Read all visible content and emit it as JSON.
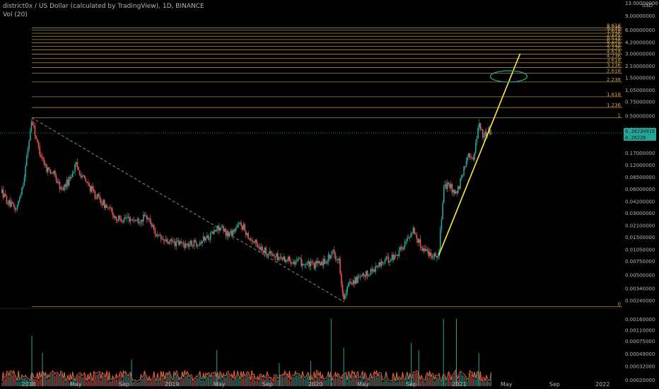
{
  "header": {
    "title": "district0x / US Dollar (calculated by TradingView), 1D, BINANCE",
    "indicator": "Vol (20)"
  },
  "colors": {
    "up": "#26a69a",
    "down": "#ef5350",
    "fib": "#c9a24b",
    "trendline": "#ffeb3b",
    "ellipse": "#26a69a",
    "volume_ma": "#ff7043",
    "price_line": "#26a69a"
  },
  "chart_data": {
    "type": "candlestick",
    "scale": "log",
    "price_axis": {
      "unit_label": "USD",
      "range": [
        0.0019,
        13.0
      ],
      "ticks": [
        {
          "label": "13.00000000",
          "value": 13.0
        },
        {
          "label": "9.00000000",
          "value": 9.0
        },
        {
          "label": "6.00000000",
          "value": 6.0
        },
        {
          "label": "4.20000000",
          "value": 4.2
        },
        {
          "label": "3.00000000",
          "value": 3.0
        },
        {
          "label": "2.10000000",
          "value": 2.1
        },
        {
          "label": "1.50000000",
          "value": 1.5
        },
        {
          "label": "1.05000000",
          "value": 1.05
        },
        {
          "label": "0.75000000",
          "value": 0.75
        },
        {
          "label": "0.50000000",
          "value": 0.5
        },
        {
          "label": "0.34000000",
          "value": 0.34
        },
        {
          "label": "0.17000000",
          "value": 0.17
        },
        {
          "label": "0.12000000",
          "value": 0.12
        },
        {
          "label": "0.08500000",
          "value": 0.085
        },
        {
          "label": "0.06000000",
          "value": 0.06
        },
        {
          "label": "0.04200000",
          "value": 0.042
        },
        {
          "label": "0.03000000",
          "value": 0.03
        },
        {
          "label": "0.02100000",
          "value": 0.021
        },
        {
          "label": "0.01500000",
          "value": 0.015
        },
        {
          "label": "0.01050000",
          "value": 0.0105
        },
        {
          "label": "0.00750000",
          "value": 0.0075
        },
        {
          "label": "0.00500000",
          "value": 0.005
        },
        {
          "label": "0.00340000",
          "value": 0.0034
        },
        {
          "label": "0.00240000",
          "value": 0.0024
        }
      ]
    },
    "volume_axis": {
      "ticks": [
        {
          "label": "0.00160000",
          "value": 0.0016
        },
        {
          "label": "0.00110000",
          "value": 0.0011
        },
        {
          "label": "0.00075000",
          "value": 0.00075
        },
        {
          "label": "0.00049000",
          "value": 0.00049
        },
        {
          "label": "0.00032000",
          "value": 0.00032
        },
        {
          "label": "0.00020000",
          "value": 0.0002
        }
      ]
    },
    "time_axis": {
      "range": [
        "2017-10-20",
        "2022-02-20"
      ],
      "ticks": [
        {
          "label": "2018",
          "date": "2018-01-01"
        },
        {
          "label": "May",
          "date": "2018-05-01"
        },
        {
          "label": "Sep",
          "date": "2018-09-01"
        },
        {
          "label": "2019",
          "date": "2019-01-01"
        },
        {
          "label": "May",
          "date": "2019-05-01"
        },
        {
          "label": "Sep",
          "date": "2019-09-01"
        },
        {
          "label": "2020",
          "date": "2020-01-01"
        },
        {
          "label": "May",
          "date": "2020-05-01"
        },
        {
          "label": "Sep",
          "date": "2020-09-01"
        },
        {
          "label": "2021",
          "date": "2021-01-01"
        },
        {
          "label": "May",
          "date": "2021-05-01"
        },
        {
          "label": "Sep",
          "date": "2021-09-01"
        },
        {
          "label": "2022",
          "date": "2022-01-01"
        }
      ]
    },
    "price_path": [
      {
        "date": "2017-10-25",
        "price": 0.055
      },
      {
        "date": "2017-11-10",
        "price": 0.04
      },
      {
        "date": "2017-12-01",
        "price": 0.033
      },
      {
        "date": "2017-12-20",
        "price": 0.08
      },
      {
        "date": "2018-01-09",
        "price": 0.46
      },
      {
        "date": "2018-01-25",
        "price": 0.2
      },
      {
        "date": "2018-02-15",
        "price": 0.11
      },
      {
        "date": "2018-03-05",
        "price": 0.095
      },
      {
        "date": "2018-03-25",
        "price": 0.058
      },
      {
        "date": "2018-04-12",
        "price": 0.075
      },
      {
        "date": "2018-05-01",
        "price": 0.12
      },
      {
        "date": "2018-05-25",
        "price": 0.075
      },
      {
        "date": "2018-06-20",
        "price": 0.05
      },
      {
        "date": "2018-07-20",
        "price": 0.035
      },
      {
        "date": "2018-08-15",
        "price": 0.025
      },
      {
        "date": "2018-09-10",
        "price": 0.026
      },
      {
        "date": "2018-10-05",
        "price": 0.024
      },
      {
        "date": "2018-10-30",
        "price": 0.027
      },
      {
        "date": "2018-11-25",
        "price": 0.015
      },
      {
        "date": "2018-12-15",
        "price": 0.013
      },
      {
        "date": "2019-01-10",
        "price": 0.0125
      },
      {
        "date": "2019-02-10",
        "price": 0.012
      },
      {
        "date": "2019-03-10",
        "price": 0.013
      },
      {
        "date": "2019-04-10",
        "price": 0.016
      },
      {
        "date": "2019-05-01",
        "price": 0.02
      },
      {
        "date": "2019-05-25",
        "price": 0.016
      },
      {
        "date": "2019-06-25",
        "price": 0.022
      },
      {
        "date": "2019-07-20",
        "price": 0.014
      },
      {
        "date": "2019-08-20",
        "price": 0.0105
      },
      {
        "date": "2019-09-20",
        "price": 0.0085
      },
      {
        "date": "2019-10-25",
        "price": 0.0078
      },
      {
        "date": "2019-11-25",
        "price": 0.0072
      },
      {
        "date": "2019-12-25",
        "price": 0.0065
      },
      {
        "date": "2020-01-25",
        "price": 0.0075
      },
      {
        "date": "2020-02-15",
        "price": 0.0095
      },
      {
        "date": "2020-03-01",
        "price": 0.0075
      },
      {
        "date": "2020-03-13",
        "price": 0.0024
      },
      {
        "date": "2020-03-28",
        "price": 0.0041
      },
      {
        "date": "2020-04-25",
        "price": 0.0045
      },
      {
        "date": "2020-05-25",
        "price": 0.0058
      },
      {
        "date": "2020-06-25",
        "price": 0.0075
      },
      {
        "date": "2020-07-20",
        "price": 0.0085
      },
      {
        "date": "2020-08-15",
        "price": 0.012
      },
      {
        "date": "2020-09-05",
        "price": 0.019
      },
      {
        "date": "2020-09-25",
        "price": 0.0115
      },
      {
        "date": "2020-10-20",
        "price": 0.0092
      },
      {
        "date": "2020-11-10",
        "price": 0.0088
      },
      {
        "date": "2020-11-22",
        "price": 0.06
      },
      {
        "date": "2020-12-05",
        "price": 0.068
      },
      {
        "date": "2020-12-25",
        "price": 0.052
      },
      {
        "date": "2021-01-05",
        "price": 0.075
      },
      {
        "date": "2021-01-25",
        "price": 0.18
      },
      {
        "date": "2021-02-05",
        "price": 0.13
      },
      {
        "date": "2021-02-20",
        "price": 0.42
      },
      {
        "date": "2021-03-05",
        "price": 0.26
      },
      {
        "date": "2021-03-15",
        "price": 0.34
      },
      {
        "date": "2021-03-25",
        "price": 0.29
      }
    ],
    "volume_spikes": [
      {
        "date": "2018-01-09",
        "volume": 0.0009
      },
      {
        "date": "2018-02-05",
        "volume": 0.0005
      },
      {
        "date": "2018-09-20",
        "volume": 0.0004
      },
      {
        "date": "2019-04-25",
        "volume": 0.00055
      },
      {
        "date": "2019-10-01",
        "volume": 0.00035
      },
      {
        "date": "2019-12-20",
        "volume": 0.00038
      },
      {
        "date": "2020-02-10",
        "volume": 0.0016
      },
      {
        "date": "2020-03-13",
        "volume": 0.0006
      },
      {
        "date": "2020-09-01",
        "volume": 0.0007
      },
      {
        "date": "2020-09-20",
        "volume": 0.00055
      },
      {
        "date": "2020-11-22",
        "volume": 0.0016
      },
      {
        "date": "2020-12-25",
        "volume": 0.0016
      },
      {
        "date": "2021-02-20",
        "volume": 0.0005
      }
    ],
    "current_price_labels": [
      "0.30234919",
      "0.26226"
    ],
    "current_price": 0.302,
    "fib_extension": {
      "from": {
        "date": "2018-01-09",
        "price": 0.47
      },
      "to": {
        "date": "2020-03-13",
        "price": 0.002
      },
      "x_start": "2018-01-09",
      "x_end": "2022-02-20",
      "levels": [
        {
          "label": "0",
          "value": 0.002
        },
        {
          "label": "1",
          "value": 0.47
        },
        {
          "label": "1.236",
          "value": 0.63
        },
        {
          "label": "1.618",
          "value": 0.86
        },
        {
          "label": "2.236",
          "value": 1.32
        },
        {
          "label": "2.618",
          "value": 1.7
        },
        {
          "label": "3.236",
          "value": 2.0
        },
        {
          "label": "3.618",
          "value": 2.3
        },
        {
          "label": "4.236",
          "value": 2.6
        },
        {
          "label": "4.618",
          "value": 2.95
        },
        {
          "label": "5.236",
          "value": 3.35
        },
        {
          "label": "5.618",
          "value": 3.7
        },
        {
          "label": "6.236",
          "value": 4.1
        },
        {
          "label": "6.618",
          "value": 4.5
        },
        {
          "label": "7.236",
          "value": 4.95
        },
        {
          "label": "7.618",
          "value": 5.4
        },
        {
          "label": "8.236",
          "value": 5.9
        },
        {
          "label": "8.618",
          "value": 6.3
        }
      ]
    },
    "annotations": {
      "dashed_diagonal": {
        "from": {
          "date": "2018-01-09",
          "price": 0.47
        },
        "to": {
          "date": "2020-03-13",
          "price": 0.0023
        }
      },
      "trendline": {
        "from": {
          "date": "2020-11-10",
          "price": 0.0088
        },
        "to": {
          "date": "2021-06-05",
          "price": 3.0
        }
      },
      "ellipse": {
        "center": {
          "date": "2021-05-07",
          "price": 1.55
        }
      }
    }
  }
}
